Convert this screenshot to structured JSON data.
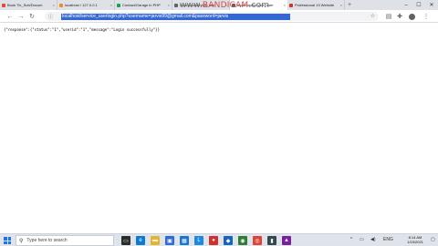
{
  "tabs": [
    {
      "label": "Book Tix_Sub/Docum",
      "color": "#e8453c"
    },
    {
      "label": "localhost / 127.0.0.1",
      "color": "#f28b1f"
    },
    {
      "label": "Contact/Garage in PHP",
      "color": "#1f9d55"
    },
    {
      "label": "localhost/service_user",
      "color": "#5f6368"
    },
    {
      "label": "localhost/service_user",
      "color": "#5f6368",
      "active": true
    },
    {
      "label": "Professional 13 Website",
      "color": "#d93025"
    }
  ],
  "tab_close_glyph": "×",
  "new_tab_glyph": "+",
  "watermark": {
    "prefix": "www.",
    "brand": "BANDICAM",
    "suffix": ".com"
  },
  "window": {
    "minimize": "–",
    "maximize": "☐",
    "close": "✕"
  },
  "toolbar": {
    "back": "←",
    "forward": "→",
    "reload": "↻",
    "home": "⌂",
    "info": "ⓘ",
    "url": "localhost/service_userlogin.php?username=jarvis99@gmail.com&password=jarvis",
    "star": "☆"
  },
  "page": {
    "json_text": "{\"response\":{\"status\":\"1\",\"userid\":\"1\",\"message\":\"Login successfully\"}}"
  },
  "taskbar": {
    "search_placeholder": "Type here to search",
    "apps": [
      {
        "icon": "task-view-icon",
        "color": "#2b2b2b",
        "glyph": "▭"
      },
      {
        "icon": "edge-icon",
        "color": "#0a7ad4",
        "glyph": "e"
      },
      {
        "icon": "file-explorer-icon",
        "color": "#e8b430",
        "glyph": "▬"
      },
      {
        "icon": "photos-icon",
        "color": "#2d6bd8",
        "glyph": "▣"
      },
      {
        "icon": "store-icon",
        "color": "#1976d2",
        "glyph": "▦"
      },
      {
        "icon": "app-l-icon",
        "color": "#1e88e5",
        "glyph": "L"
      },
      {
        "icon": "app-red-icon",
        "color": "#d32f2f",
        "glyph": "●"
      },
      {
        "icon": "app-blue-icon",
        "color": "#1565c0",
        "glyph": "◆"
      },
      {
        "icon": "app-green-icon",
        "color": "#2e7d32",
        "glyph": "◉"
      },
      {
        "icon": "chrome-icon",
        "color": "#db4437",
        "glyph": "◎"
      },
      {
        "icon": "app-dark-icon",
        "color": "#37474f",
        "glyph": "▮"
      },
      {
        "icon": "app-purple-icon",
        "color": "#7b1fa2",
        "glyph": "▲"
      }
    ],
    "clock_time": "8:14 AM",
    "clock_date": "1/15/2021"
  }
}
